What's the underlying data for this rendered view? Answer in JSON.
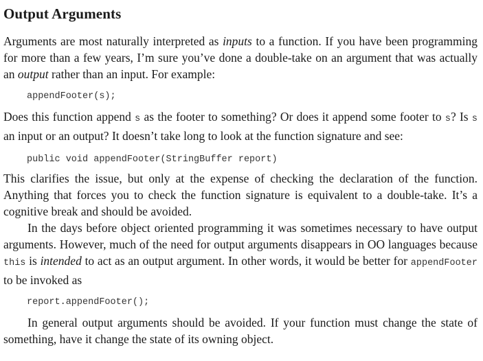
{
  "section": {
    "heading": "Output Arguments"
  },
  "paragraph1": {
    "t1": "Arguments are most naturally interpreted as ",
    "em1": "inputs",
    "t2": " to a function. If you have been programming for more than a few years, I’m sure you’ve done a double-take on an argument that was actually an ",
    "em2": "output",
    "t3": " rather than an input. For example:"
  },
  "code_example1": "appendFooter(s);",
  "paragraph2": {
    "t1": "Does this function append ",
    "c1": "s",
    "t2": " as the footer to something? Or does it append some footer to ",
    "c2": "s",
    "t3": "? Is ",
    "c3": "s",
    "t4": " an input or an output? It doesn’t take long to look at the function signature and see:"
  },
  "code_example2": "public void appendFooter(StringBuffer report)",
  "paragraph3": {
    "text": "This clarifies the issue, but only at the expense of checking the declaration of the function. Anything that forces you to check the function signature is equivalent to a double-take. It’s a cognitive break and should be avoided."
  },
  "paragraph4": {
    "t1": "In the days before object oriented programming it was sometimes necessary to have output arguments. However, much of the need for output arguments disappears in OO languages because ",
    "c1": "this",
    "t2": " is ",
    "em1": "intended",
    "t3": " to act as an output argument. In other words, it would be better for ",
    "c2": "appendFooter",
    "t4": " to be invoked as"
  },
  "code_example3": "report.appendFooter();",
  "paragraph5": {
    "text": "In general output arguments should be avoided. If your function must change the state of something, have it change the state of its owning object."
  }
}
